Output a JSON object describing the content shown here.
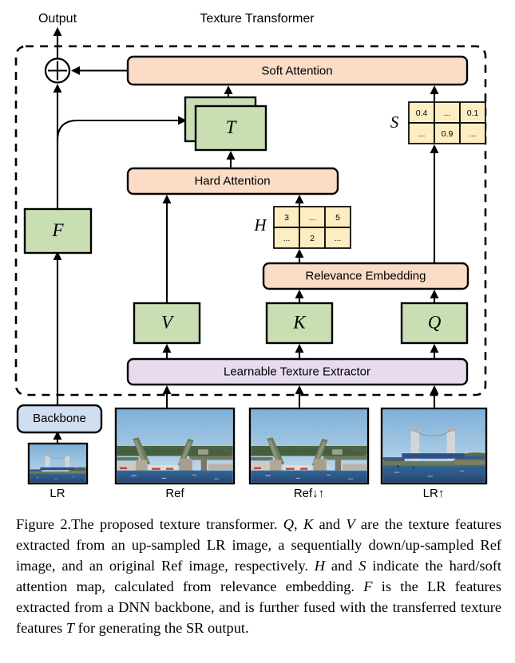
{
  "figure": {
    "top_labels": {
      "output": "Output",
      "title": "Texture Transformer"
    },
    "blocks": {
      "soft_attention": "Soft Attention",
      "hard_attention": "Hard Attention",
      "relevance_embedding": "Relevance Embedding",
      "learnable_texture_extractor": "Learnable Texture Extractor",
      "backbone": "Backbone",
      "feature_T": "T",
      "feature_F": "F",
      "feature_V": "V",
      "feature_K": "K",
      "feature_Q": "Q"
    },
    "matrices": {
      "S": {
        "label": "S",
        "rows": [
          [
            "0.4",
            "...",
            "0.1"
          ],
          [
            "...",
            "0.9",
            "..."
          ]
        ]
      },
      "H": {
        "label": "H",
        "rows": [
          [
            "3",
            "...",
            "5"
          ],
          [
            "...",
            "2",
            "..."
          ]
        ]
      }
    },
    "image_captions": {
      "lr": "LR",
      "ref": "Ref",
      "ref_down_up": "Ref↓↑",
      "lr_up": "LR↑"
    },
    "colors": {
      "attention_block": "#fadcc7",
      "feature_block": "#cadeb4",
      "matrix_cell": "#fceec2",
      "extractor_block": "#e7dcef",
      "backbone_block": "#cfdff0",
      "outline": "#000000",
      "sky": "#9fc4e0",
      "water": "#2e5d8c"
    }
  },
  "caption": {
    "number": "Figure 2.",
    "line1_a": "The proposed texture transformer. ",
    "q": "Q",
    "line1_b": ", ",
    "k": "K",
    "line1_c": " and ",
    "v": "V",
    "line1_d": " are the texture features extracted from an up-sampled LR image, a sequentially down/up-sampled Ref image, and an original Ref image, respectively. ",
    "h": "H",
    "line2_a": " and ",
    "s": "S",
    "line2_b": " indicate the hard/soft attention map, calculated from relevance embedding. ",
    "f": "F",
    "line3_a": " is the LR features extracted from a DNN backbone, and is further fused with the transferred texture features ",
    "t": "T",
    "line3_b": " for generating the SR output."
  }
}
